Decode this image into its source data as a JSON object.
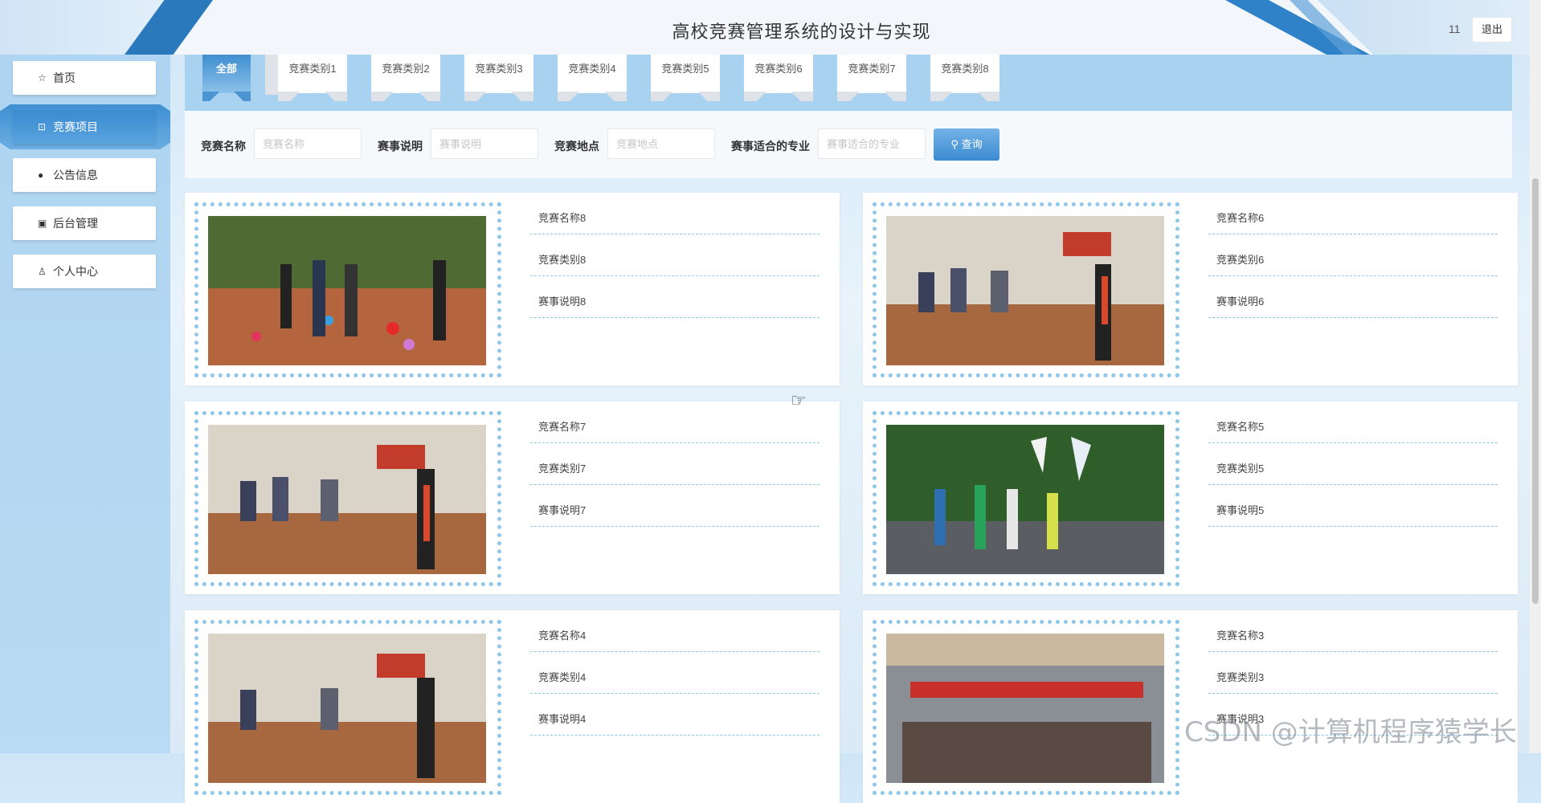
{
  "header": {
    "title": "高校竞赛管理系统的设计与实现",
    "user": "11",
    "logout_label": "退出"
  },
  "sidebar": {
    "items": [
      {
        "label": "首页",
        "icon": "star-icon"
      },
      {
        "label": "竞赛项目",
        "icon": "bag-icon",
        "active": true
      },
      {
        "label": "公告信息",
        "icon": "alert-icon"
      },
      {
        "label": "后台管理",
        "icon": "briefcase-icon"
      },
      {
        "label": "个人中心",
        "icon": "user-icon"
      }
    ]
  },
  "tabs": [
    "全部",
    "竞赛类别1",
    "竞赛类别2",
    "竞赛类别3",
    "竞赛类别4",
    "竞赛类别5",
    "竞赛类别6",
    "竞赛类别7",
    "竞赛类别8"
  ],
  "search": {
    "fields": [
      {
        "label": "竞赛名称",
        "placeholder": "竞赛名称"
      },
      {
        "label": "赛事说明",
        "placeholder": "赛事说明"
      },
      {
        "label": "竞赛地点",
        "placeholder": "竞赛地点"
      },
      {
        "label": "赛事适合的专业",
        "placeholder": "赛事适合的专业"
      }
    ],
    "button_label": "查询"
  },
  "cards": [
    {
      "name": "竞赛名称8",
      "category": "竞赛类别8",
      "desc": "赛事说明8"
    },
    {
      "name": "竞赛名称6",
      "category": "竞赛类别6",
      "desc": "赛事说明6"
    },
    {
      "name": "竞赛名称7",
      "category": "竞赛类别7",
      "desc": "赛事说明7"
    },
    {
      "name": "竞赛名称5",
      "category": "竞赛类别5",
      "desc": "赛事说明5"
    },
    {
      "name": "竞赛名称4",
      "category": "竞赛类别4",
      "desc": "赛事说明4"
    },
    {
      "name": "竞赛名称3",
      "category": "竞赛类别3",
      "desc": "赛事说明3"
    }
  ],
  "watermark": "CSDN @计算机程序猿学长",
  "colors": {
    "accent": "#3a8bd0",
    "frame": "#8ec7ea",
    "band": "#a9d1f0"
  }
}
